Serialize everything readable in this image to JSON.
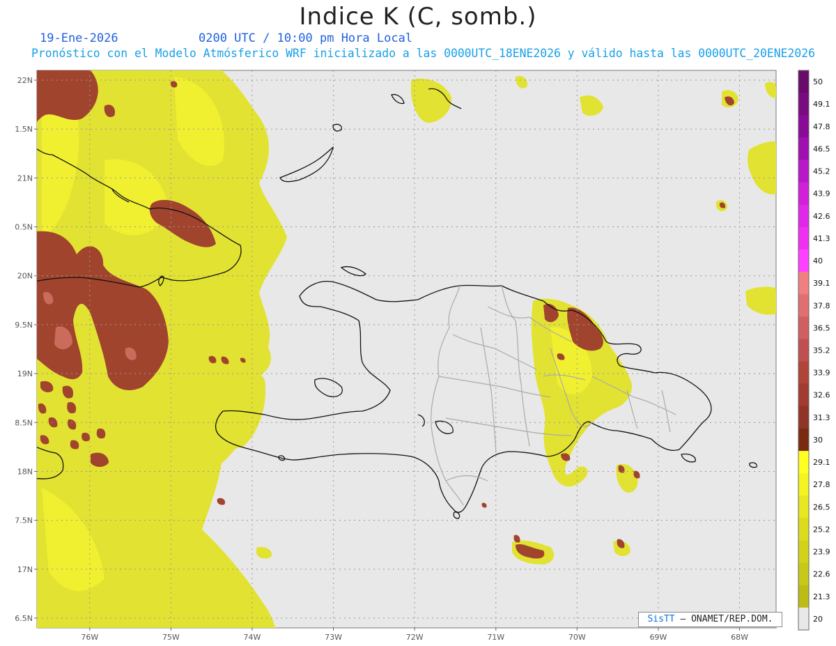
{
  "header": {
    "title": "Indice K (C, somb.)",
    "date": "19-Ene-2026",
    "time": "0200 UTC / 10:00 pm Hora Local",
    "description": "Pronóstico con el Modelo Atmósferico WRF inicializado a las 0000UTC_18ENE2026 y válido hasta las  0000UTC_20ENE2026"
  },
  "map": {
    "lon_range": [
      -76.65,
      -67.55
    ],
    "lat_range": [
      16.4,
      22.1
    ],
    "lat_labels": [
      {
        "lat": 22.0,
        "label": "22N"
      },
      {
        "lat": 21.5,
        "label": "1.5N"
      },
      {
        "lat": 21.0,
        "label": "21N"
      },
      {
        "lat": 20.5,
        "label": "0.5N"
      },
      {
        "lat": 20.0,
        "label": "20N"
      },
      {
        "lat": 19.5,
        "label": "9.5N"
      },
      {
        "lat": 19.0,
        "label": "19N"
      },
      {
        "lat": 18.5,
        "label": "8.5N"
      },
      {
        "lat": 18.0,
        "label": "18N"
      },
      {
        "lat": 17.5,
        "label": "7.5N"
      },
      {
        "lat": 17.0,
        "label": "17N"
      },
      {
        "lat": 16.5,
        "label": "6.5N"
      }
    ],
    "lon_labels": [
      {
        "lon": -76,
        "label": "76W"
      },
      {
        "lon": -75,
        "label": "75W"
      },
      {
        "lon": -74,
        "label": "74W"
      },
      {
        "lon": -73,
        "label": "73W"
      },
      {
        "lon": -72,
        "label": "72W"
      },
      {
        "lon": -71,
        "label": "71W"
      },
      {
        "lon": -70,
        "label": "70W"
      },
      {
        "lon": -69,
        "label": "69W"
      },
      {
        "lon": -68,
        "label": "68W"
      }
    ],
    "background_color": "#e8e8e8"
  },
  "colorbar": {
    "levels": [
      {
        "label": "50",
        "color": "#6a0a6a"
      },
      {
        "label": "49.1",
        "color": "#7a0a80"
      },
      {
        "label": "47.8",
        "color": "#8a0a98"
      },
      {
        "label": "46.5",
        "color": "#a010b0"
      },
      {
        "label": "45.2",
        "color": "#b818c8"
      },
      {
        "label": "43.9",
        "color": "#d020d8"
      },
      {
        "label": "42.6",
        "color": "#e028e8"
      },
      {
        "label": "41.3",
        "color": "#f030f0"
      },
      {
        "label": "40",
        "color": "#ff40ff"
      },
      {
        "label": "39.1",
        "color": "#f08080"
      },
      {
        "label": "37.8",
        "color": "#e07070"
      },
      {
        "label": "36.5",
        "color": "#d06060"
      },
      {
        "label": "35.2",
        "color": "#c05050"
      },
      {
        "label": "33.9",
        "color": "#b04438"
      },
      {
        "label": "32.6",
        "color": "#a03c30"
      },
      {
        "label": "31.3",
        "color": "#903428"
      },
      {
        "label": "30",
        "color": "#7a2a10"
      },
      {
        "label": "29.1",
        "color": "#ffff20"
      },
      {
        "label": "27.8",
        "color": "#f4f420"
      },
      {
        "label": "26.5",
        "color": "#e8e820"
      },
      {
        "label": "25.2",
        "color": "#dcdc1c"
      },
      {
        "label": "23.9",
        "color": "#d2d21a"
      },
      {
        "label": "22.6",
        "color": "#c8c818"
      },
      {
        "label": "21.3",
        "color": "#bcbc16"
      },
      {
        "label": "20",
        "color": "#e8e8e8"
      }
    ]
  },
  "credit": {
    "brand": "SisTT",
    "text": "– ONAMET/REP.DOM."
  }
}
